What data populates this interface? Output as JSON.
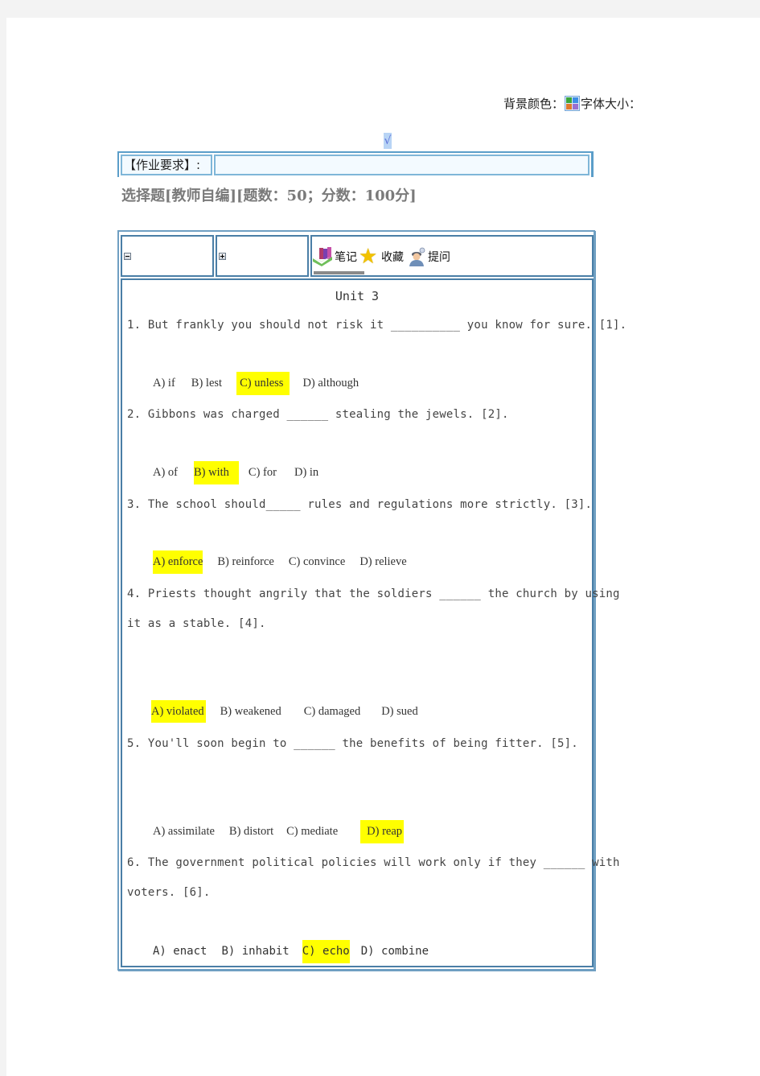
{
  "settings": {
    "bg_color_label": "背景颜色：",
    "font_size_label": "字体大小：",
    "palette_colors": [
      "#3aa63a",
      "#3d8ee6",
      "#e07a2e",
      "#9a6fd1"
    ]
  },
  "checkmark": "√",
  "requirement": {
    "label": "【作业要求】:",
    "value": ""
  },
  "section_title": "选择题[教师自编][题数：50；分数：100分]",
  "toolbar": {
    "collapse_icon": "minus-box",
    "expand_icon": "plus-box",
    "notes_label": "笔记",
    "favorite_label": "收藏",
    "ask_label": "提问"
  },
  "unit_title": "Unit 3",
  "highlight_color": "#ffff00",
  "questions": [
    {
      "stem_lines": [
        "1. But frankly you should not risk it __________ you know for sure. [1]."
      ],
      "options": [
        "A) if",
        "B) lest",
        "C) unless",
        "D) although"
      ],
      "answer": "C"
    },
    {
      "stem_lines": [
        "2. Gibbons was charged ______ stealing the jewels. [2]."
      ],
      "options": [
        "A) of",
        "B) with",
        "C) for",
        "D) in"
      ],
      "answer": "B"
    },
    {
      "stem_lines": [
        "3. The school should_____ rules and regulations more strictly. [3]."
      ],
      "options": [
        "A) enforce",
        "B) reinforce",
        "C) convince",
        "D) relieve"
      ],
      "answer": "A"
    },
    {
      "stem_lines": [
        "4. Priests thought angrily that the soldiers ______ the church by using",
        "it as a stable. [4]."
      ],
      "options": [
        "A) violated",
        "B) weakened",
        "C) damaged",
        "D) sued"
      ],
      "answer": "A"
    },
    {
      "stem_lines": [
        "5. You'll soon begin to ______ the benefits of being fitter. [5]."
      ],
      "options": [
        "A) assimilate",
        "B) distort",
        "C) mediate",
        "D) reap"
      ],
      "answer": "D"
    },
    {
      "stem_lines": [
        "6. The government political policies will work only if they ______ with",
        "voters. [6]."
      ],
      "options": [
        "A) enact",
        "B) inhabit",
        "C) echo",
        "D) combine"
      ],
      "answer": "C"
    }
  ]
}
